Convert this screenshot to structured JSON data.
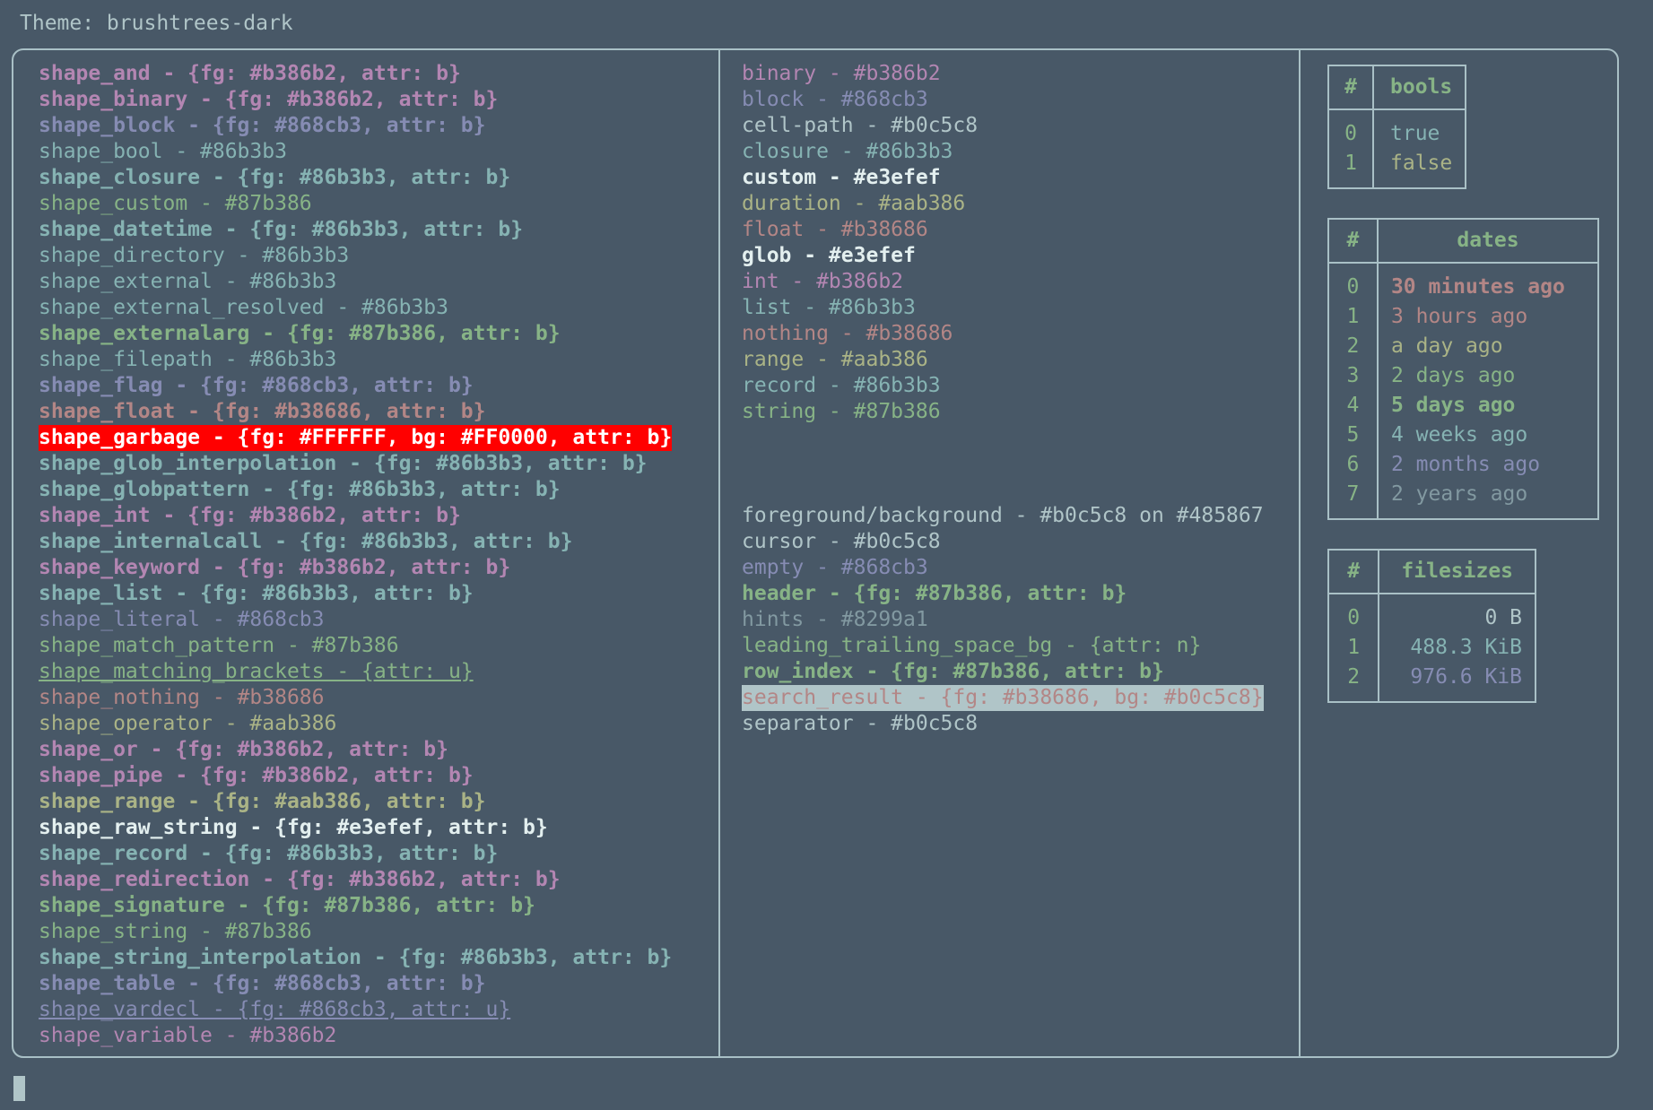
{
  "header": {
    "theme_label": "Theme: brushtrees-dark"
  },
  "shapes": [
    {
      "text": "shape_and - {fg: #b386b2, attr: b}",
      "cls": "c-pink b"
    },
    {
      "text": "shape_binary - {fg: #b386b2, attr: b}",
      "cls": "c-pink b"
    },
    {
      "text": "shape_block - {fg: #868cb3, attr: b}",
      "cls": "c-purple b"
    },
    {
      "text": "shape_bool - #86b3b3",
      "cls": "c-teal"
    },
    {
      "text": "shape_closure - {fg: #86b3b3, attr: b}",
      "cls": "c-teal b"
    },
    {
      "text": "shape_custom - #87b386",
      "cls": "c-green"
    },
    {
      "text": "shape_datetime - {fg: #86b3b3, attr: b}",
      "cls": "c-teal b"
    },
    {
      "text": "shape_directory - #86b3b3",
      "cls": "c-teal"
    },
    {
      "text": "shape_external - #86b3b3",
      "cls": "c-teal"
    },
    {
      "text": "shape_external_resolved - #86b3b3",
      "cls": "c-teal"
    },
    {
      "text": "shape_externalarg - {fg: #87b386, attr: b}",
      "cls": "c-green b"
    },
    {
      "text": "shape_filepath - #86b3b3",
      "cls": "c-teal"
    },
    {
      "text": "shape_flag - {fg: #868cb3, attr: b}",
      "cls": "c-purple b"
    },
    {
      "text": "shape_float - {fg: #b38686, attr: b}",
      "cls": "c-salmon b"
    },
    {
      "text": "shape_garbage - {fg: #FFFFFF, bg: #FF0000, attr: b}",
      "cls": "garbage"
    },
    {
      "text": "shape_glob_interpolation - {fg: #86b3b3, attr: b}",
      "cls": "c-teal b"
    },
    {
      "text": "shape_globpattern - {fg: #86b3b3, attr: b}",
      "cls": "c-teal b"
    },
    {
      "text": "shape_int - {fg: #b386b2, attr: b}",
      "cls": "c-pink b"
    },
    {
      "text": "shape_internalcall - {fg: #86b3b3, attr: b}",
      "cls": "c-teal b"
    },
    {
      "text": "shape_keyword - {fg: #b386b2, attr: b}",
      "cls": "c-pink b"
    },
    {
      "text": "shape_list - {fg: #86b3b3, attr: b}",
      "cls": "c-teal b"
    },
    {
      "text": "shape_literal - #868cb3",
      "cls": "c-purple"
    },
    {
      "text": "shape_match_pattern - #87b386",
      "cls": "c-green"
    },
    {
      "text": "shape_matching_brackets - {attr: u}",
      "cls": "c-green u"
    },
    {
      "text": "shape_nothing - #b38686",
      "cls": "c-salmon"
    },
    {
      "text": "shape_operator - #aab386",
      "cls": "c-yellow"
    },
    {
      "text": "shape_or - {fg: #b386b2, attr: b}",
      "cls": "c-pink b"
    },
    {
      "text": "shape_pipe - {fg: #b386b2, attr: b}",
      "cls": "c-pink b"
    },
    {
      "text": "shape_range - {fg: #aab386, attr: b}",
      "cls": "c-yellow b"
    },
    {
      "text": "shape_raw_string - {fg: #e3efef, attr: b}",
      "cls": "c-white b"
    },
    {
      "text": "shape_record - {fg: #86b3b3, attr: b}",
      "cls": "c-teal b"
    },
    {
      "text": "shape_redirection - {fg: #b386b2, attr: b}",
      "cls": "c-pink b"
    },
    {
      "text": "shape_signature - {fg: #87b386, attr: b}",
      "cls": "c-green b"
    },
    {
      "text": "shape_string - #87b386",
      "cls": "c-green"
    },
    {
      "text": "shape_string_interpolation - {fg: #86b3b3, attr: b}",
      "cls": "c-teal b"
    },
    {
      "text": "shape_table - {fg: #868cb3, attr: b}",
      "cls": "c-purple b"
    },
    {
      "text": "shape_vardecl - {fg: #868cb3, attr: u}",
      "cls": "c-purple u"
    },
    {
      "text": "shape_variable - #b386b2",
      "cls": "c-pink"
    }
  ],
  "types": [
    {
      "text": "binary - #b386b2",
      "cls": "c-pink"
    },
    {
      "text": "block - #868cb3",
      "cls": "c-purple"
    },
    {
      "text": "cell-path - #b0c5c8",
      "cls": "c-def"
    },
    {
      "text": "closure - #86b3b3",
      "cls": "c-teal"
    },
    {
      "text": "custom - #e3efef",
      "cls": "c-white b"
    },
    {
      "text": "duration - #aab386",
      "cls": "c-yellow"
    },
    {
      "text": "float - #b38686",
      "cls": "c-salmon"
    },
    {
      "text": "glob - #e3efef",
      "cls": "c-white b"
    },
    {
      "text": "int - #b386b2",
      "cls": "c-pink"
    },
    {
      "text": "list - #86b3b3",
      "cls": "c-teal"
    },
    {
      "text": "nothing - #b38686",
      "cls": "c-salmon"
    },
    {
      "text": "range - #aab386",
      "cls": "c-yellow"
    },
    {
      "text": "record - #86b3b3",
      "cls": "c-teal"
    },
    {
      "text": "string - #87b386",
      "cls": "c-green"
    }
  ],
  "ui_elements": [
    {
      "text": "foreground/background - #b0c5c8 on #485867",
      "cls": "c-def"
    },
    {
      "text": "cursor - #b0c5c8",
      "cls": "c-def"
    },
    {
      "text": "empty - #868cb3",
      "cls": "c-purple"
    },
    {
      "text": "header - {fg: #87b386, attr: b}",
      "cls": "c-green b"
    },
    {
      "text": "hints - #8299a1",
      "cls": "c-hint"
    },
    {
      "text": "leading_trailing_space_bg - {attr: n}",
      "cls": "c-green"
    },
    {
      "text": "row_index - {fg: #87b386, attr: b}",
      "cls": "c-green b"
    },
    {
      "text": "search_result - {fg: #b38686, bg: #b0c5c8}",
      "cls": "searchres"
    },
    {
      "text": "separator - #b0c5c8",
      "cls": "c-def"
    }
  ],
  "tables": {
    "bools": {
      "index_header": "#",
      "value_header": "bools",
      "rows": [
        {
          "index": "0",
          "value": "true",
          "cls": "c-teal"
        },
        {
          "index": "1",
          "value": "false",
          "cls": "c-yellow"
        }
      ]
    },
    "dates": {
      "index_header": "#",
      "value_header": "dates",
      "rows": [
        {
          "index": "0",
          "value": "30 minutes ago",
          "cls": "c-salmon b"
        },
        {
          "index": "1",
          "value": "3 hours ago",
          "cls": "c-salmon"
        },
        {
          "index": "2",
          "value": "a day ago",
          "cls": "c-yellow"
        },
        {
          "index": "3",
          "value": "2 days ago",
          "cls": "c-green"
        },
        {
          "index": "4",
          "value": "5 days ago",
          "cls": "c-green b"
        },
        {
          "index": "5",
          "value": "4 weeks ago",
          "cls": "c-teal"
        },
        {
          "index": "6",
          "value": "2 months ago",
          "cls": "c-purple"
        },
        {
          "index": "7",
          "value": "2 years ago",
          "cls": "c-hint"
        }
      ]
    },
    "filesizes": {
      "index_header": "#",
      "value_header": "filesizes",
      "rows": [
        {
          "index": "0",
          "value": "0 B",
          "cls": "c-def"
        },
        {
          "index": "1",
          "value": "488.3 KiB",
          "cls": "c-teal"
        },
        {
          "index": "2",
          "value": "976.6 KiB",
          "cls": "c-purple"
        }
      ]
    }
  },
  "colors": {
    "background": "#485867",
    "foreground": "#b0c5c8",
    "border": "#a9c0c6",
    "pink": "#b386b2",
    "purple": "#868cb3",
    "teal": "#86b3b3",
    "green": "#87b386",
    "salmon": "#b38686",
    "yellow": "#aab386",
    "white": "#e3efef",
    "hint": "#8299a1",
    "garbage_fg": "#FFFFFF",
    "garbage_bg": "#FF0000"
  }
}
